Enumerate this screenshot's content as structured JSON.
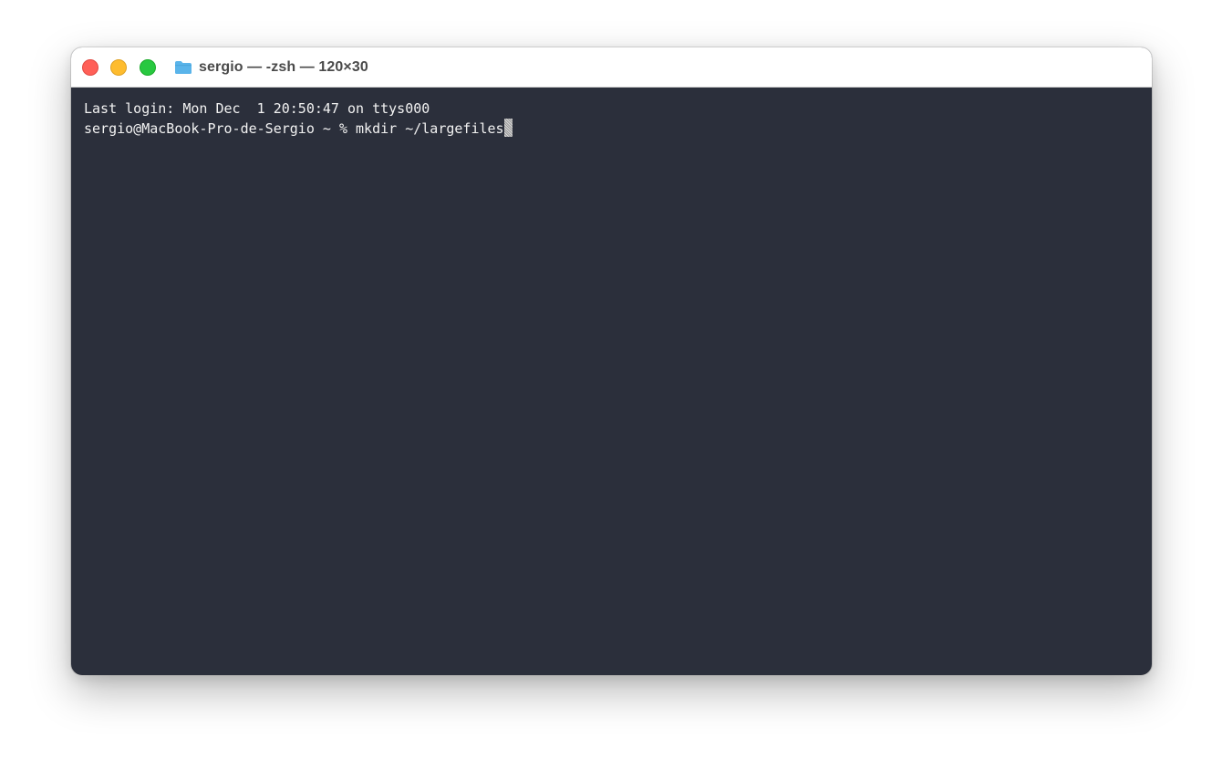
{
  "window": {
    "title": "sergio — -zsh — 120×30",
    "icon": "folder-icon"
  },
  "terminal": {
    "lines": [
      "Last login: Mon Dec  1 20:50:47 on ttys000",
      "sergio@MacBook-Pro-de-Sergio ~ % mkdir ~/largefiles"
    ]
  },
  "colors": {
    "terminal_background": "#2b2f3b",
    "terminal_text": "#f2f2f2",
    "close": "#ff5f57",
    "minimize": "#febc2e",
    "zoom": "#28c840",
    "folder": "#5ab4ea"
  }
}
